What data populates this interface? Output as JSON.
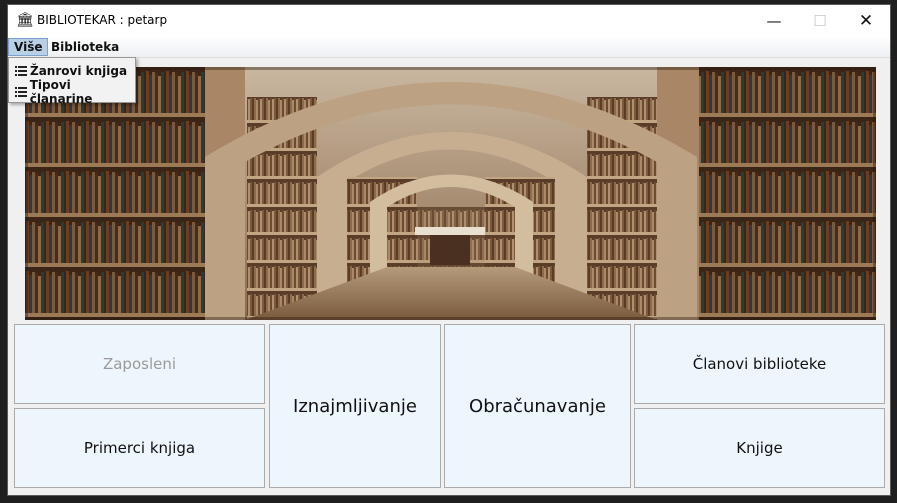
{
  "window": {
    "title": "BIBLIOTEKAR : petarp",
    "icon": "library-building-icon"
  },
  "menubar": {
    "items": [
      {
        "label": "Više"
      },
      {
        "label": "Biblioteka"
      }
    ]
  },
  "dropdown": {
    "items": [
      {
        "label": "Žanrovi knjiga",
        "icon": "list-icon"
      },
      {
        "label": "Tipovi članarine",
        "icon": "list-icon"
      }
    ]
  },
  "buttons": {
    "zaposleni": "Zaposleni",
    "primerci": "Primerci knjiga",
    "iznajmljivanje": "Iznajmljivanje",
    "obracunavanje": "Obračunavanje",
    "clanovi": "Članovi biblioteke",
    "knjige": "Knjige"
  },
  "colors": {
    "button_bg": "#eef6fd",
    "menu_highlight": "#b8cfe5",
    "disabled_text": "#9a9a9a"
  }
}
